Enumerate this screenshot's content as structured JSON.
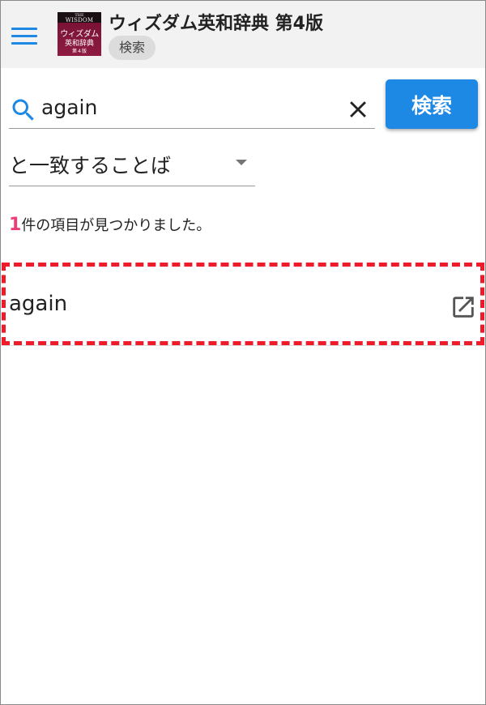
{
  "app_bar": {
    "title": "ウィズダム英和辞典 第4版",
    "chip_label": "検索",
    "menu_icon": "hamburger-menu-icon",
    "cover": {
      "line1": "THE",
      "line2": "WISDOM",
      "line3": "ウィズダム",
      "line4": "英和辞典",
      "line5": "第４版",
      "color": "#8e1a42"
    }
  },
  "search": {
    "icon": "search-icon",
    "value": "again",
    "placeholder": "",
    "clear_icon": "close-icon",
    "button_label": "検索",
    "button_color": "#1e88e5"
  },
  "match_mode": {
    "selected": "と一致することば",
    "icon": "dropdown-caret-icon"
  },
  "results": {
    "count": "1",
    "count_suffix": "件の項目が見つかりました。",
    "count_color": "#ee3d7b",
    "items": [
      {
        "word": "again",
        "action_icon": "open-in-new-icon"
      }
    ],
    "highlight_color": "#ee1c2a"
  }
}
